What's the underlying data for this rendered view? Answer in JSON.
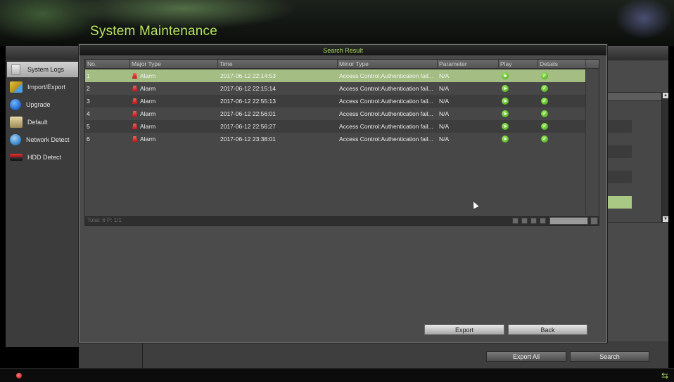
{
  "app": {
    "title": "System Maintenance"
  },
  "sidebar": {
    "items": [
      {
        "label": "System Logs",
        "icon": "log-icon",
        "active": true
      },
      {
        "label": "Import/Export",
        "icon": "import-export-icon",
        "active": false
      },
      {
        "label": "Upgrade",
        "icon": "upgrade-icon",
        "active": false
      },
      {
        "label": "Default",
        "icon": "default-icon",
        "active": false
      },
      {
        "label": "Network Detect",
        "icon": "network-detect-icon",
        "active": false
      },
      {
        "label": "HDD Detect",
        "icon": "hdd-icon",
        "active": false
      }
    ]
  },
  "dialog": {
    "title": "Search Result",
    "columns": [
      "No.",
      "Major Type",
      "Time",
      "Minor Type",
      "Parameter",
      "Play",
      "Details"
    ],
    "rows": [
      {
        "no": "1",
        "major": "Alarm",
        "time": "2017-06-12 22:14:53",
        "minor": "Access Control:Authentication fail...",
        "param": "N/A"
      },
      {
        "no": "2",
        "major": "Alarm",
        "time": "2017-06-12 22:15:14",
        "minor": "Access Control:Authentication fail...",
        "param": "N/A"
      },
      {
        "no": "3",
        "major": "Alarm",
        "time": "2017-06-12 22:55:13",
        "minor": "Access Control:Authentication fail...",
        "param": "N/A"
      },
      {
        "no": "4",
        "major": "Alarm",
        "time": "2017-06-12 22:56:01",
        "minor": "Access Control:Authentication fail...",
        "param": "N/A"
      },
      {
        "no": "5",
        "major": "Alarm",
        "time": "2017-06-12 22:56:27",
        "minor": "Access Control:Authentication fail...",
        "param": "N/A"
      },
      {
        "no": "6",
        "major": "Alarm",
        "time": "2017-06-12 23:38:01",
        "minor": "Access Control:Authentication fail...",
        "param": "N/A"
      }
    ],
    "selected_row": 1,
    "footer_text": "Total: 6  P: 1/1",
    "export_label": "Export",
    "back_label": "Back"
  },
  "bottom": {
    "export_all_label": "Export All",
    "search_label": "Search"
  },
  "colors": {
    "accent": "#b8e35f",
    "selected_row": "#a3bd83",
    "alarm": "#d42020",
    "play": "#4caf1e"
  }
}
